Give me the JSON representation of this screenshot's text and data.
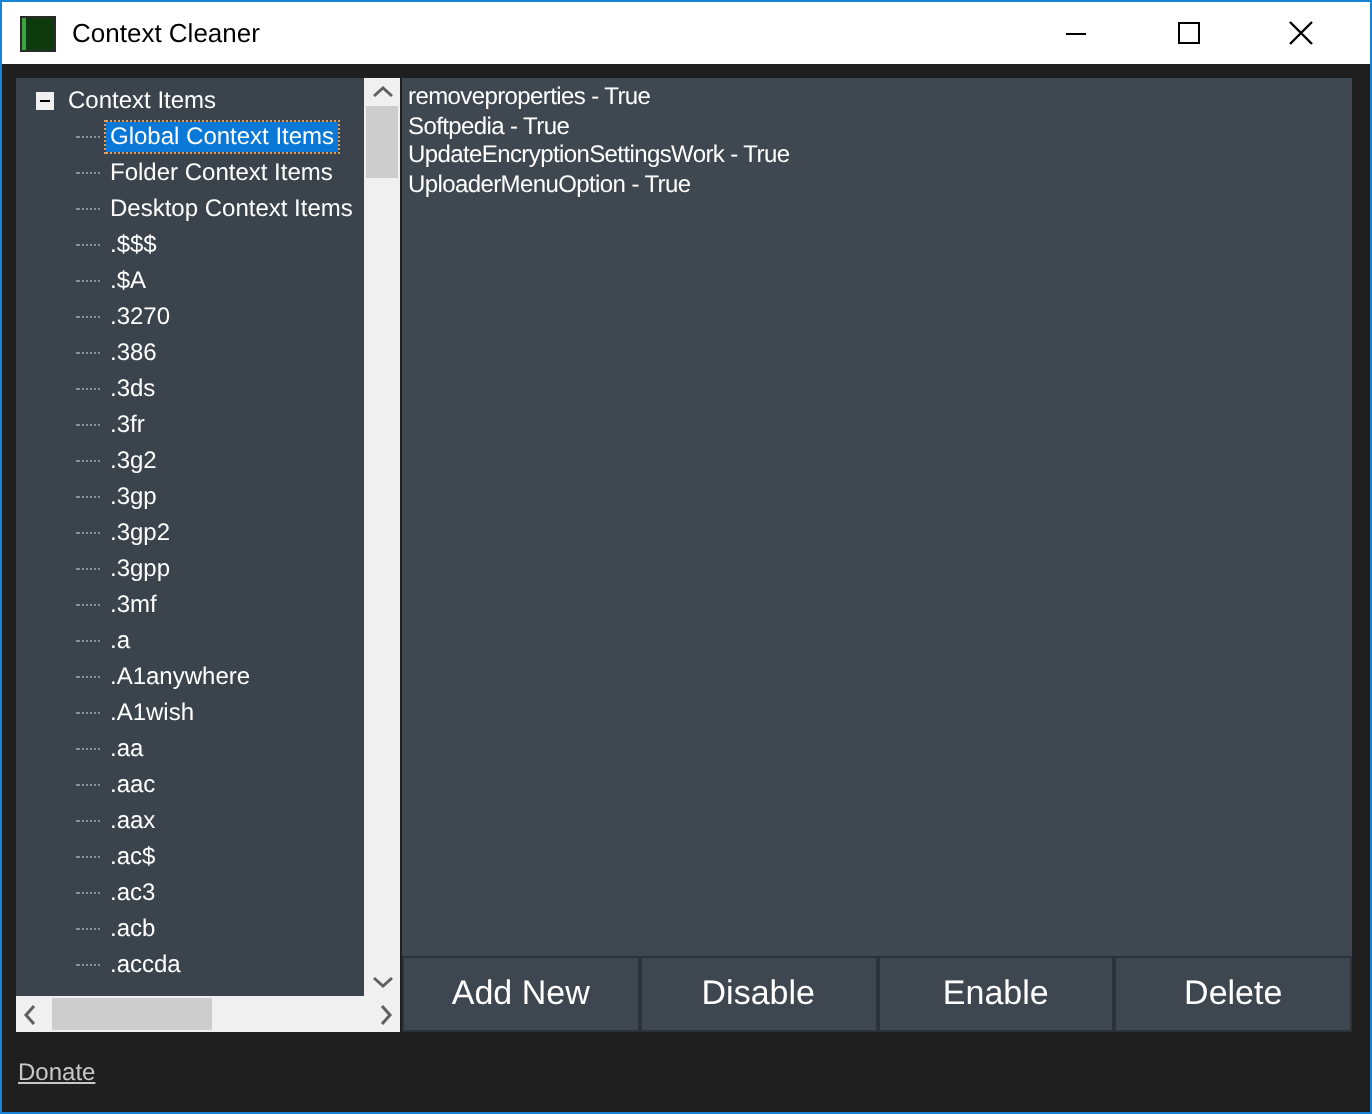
{
  "window": {
    "title": "Context Cleaner"
  },
  "tree": [
    {
      "label": "Context Items",
      "expanded": true,
      "selected": false,
      "children": [
        {
          "label": "Global Context Items",
          "selected": true
        },
        {
          "label": "Folder Context Items",
          "selected": false
        },
        {
          "label": "Desktop Context Items",
          "selected": false
        },
        {
          "label": ".$$$",
          "selected": false
        },
        {
          "label": ".$A",
          "selected": false
        },
        {
          "label": ".3270",
          "selected": false
        },
        {
          "label": ".386",
          "selected": false
        },
        {
          "label": ".3ds",
          "selected": false
        },
        {
          "label": ".3fr",
          "selected": false
        },
        {
          "label": ".3g2",
          "selected": false
        },
        {
          "label": ".3gp",
          "selected": false
        },
        {
          "label": ".3gp2",
          "selected": false
        },
        {
          "label": ".3gpp",
          "selected": false
        },
        {
          "label": ".3mf",
          "selected": false
        },
        {
          "label": ".a",
          "selected": false
        },
        {
          "label": ".A1anywhere",
          "selected": false
        },
        {
          "label": ".A1wish",
          "selected": false
        },
        {
          "label": ".aa",
          "selected": false
        },
        {
          "label": ".aac",
          "selected": false
        },
        {
          "label": ".aax",
          "selected": false
        },
        {
          "label": ".ac$",
          "selected": false
        },
        {
          "label": ".ac3",
          "selected": false
        },
        {
          "label": ".acb",
          "selected": false
        },
        {
          "label": ".accda",
          "selected": false
        }
      ]
    }
  ],
  "entries": [
    "removeproperties - True",
    "Softpedia - True",
    "UpdateEncryptionSettingsWork - True",
    "UploaderMenuOption - True"
  ],
  "buttons": [
    "Add New",
    "Disable",
    "Enable",
    "Delete"
  ],
  "status_bar": {
    "link": "Donate"
  }
}
